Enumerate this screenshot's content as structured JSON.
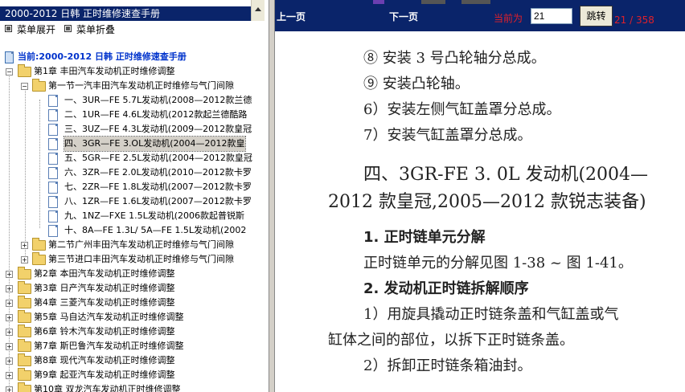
{
  "left_panel": {
    "title": "2000-2012 日韩  正时维修速查手册",
    "menu_expand": "菜单展开",
    "menu_collapse": "菜单折叠",
    "tree": {
      "root": "当前:2000-2012 日韩  正时维修速查手册",
      "chapter1": "第1章  丰田汽车发动机正时维修调整",
      "section1": "第一节一汽丰田汽车发动机正时维修与气门间隙",
      "items": [
        "一、3UR—FE 5.7L发动机(2008—2012款兰德",
        "二、1UR—FE 4.6L发动机(2012款起兰德酷路",
        "三、3UZ—FE 4.3L发动机(2009—2012款皇冠",
        "四、3GR—FE 3.OL发动机(2004—2012款皇",
        "五、5GR—FE 2.5L发动机(2004—2012款皇冠",
        "六、3ZR—FE 2.0L发动机(2010—2012款卡罗",
        "七、2ZR—FE 1.8L发动机(2007—2012款卡罗",
        "八、1ZR—FE 1.6L发动机(2007—2012款卡罗",
        "九、1NZ—FXE 1.5L发动机(2006款起普锐斯",
        "十、8A—FE 1.3L/ 5A—FE 1.5L发动机(2002"
      ],
      "section2": "第二节广州丰田汽车发动机正时维修与气门间隙",
      "section3": "第三节进口丰田汽车发动机正时维修与气门间隙",
      "chapters": [
        "第2章  本田汽车发动机正时维修调整",
        "第3章  日产汽车发动机正时维修调整",
        "第4章  三菱汽车发动机正时维修调整",
        "第5章  马自达汽车发动机正时维修调整",
        "第6章  铃木汽车发动机正时维修调整",
        "第7章  斯巴鲁汽车发动机正时维修调整",
        "第8章  现代汽车发动机正时维修调整",
        "第9章  起亚汽车发动机正时维修调整",
        "第10章  双龙汽车发动机正时维修调整"
      ]
    }
  },
  "toolbar": {
    "prev": "上一页",
    "next": "下一页",
    "current_label": "当前为",
    "page_value": "21",
    "jump": "跳转",
    "page_count": "21 / 358"
  },
  "content": {
    "lines": [
      "⑧ 安装 3 号凸轮轴分总成。",
      "⑨ 安装凸轮轴。",
      "6）安装左侧气缸盖罩分总成。",
      "7）安装气缸盖罩分总成。"
    ],
    "heading_line1": "四、3GR-FE 3. 0L 发动机(2004—",
    "heading_line2": "2012 款皇冠,2005—2012 款锐志装备)",
    "sub1": "1. 正时链单元分解",
    "sub1_text": "正时链单元的分解见图 1-38 ~ 图 1-41。",
    "sub2": "2. 发动机正时链拆解顺序",
    "step1_line1": "1）用旋具撬动正时链条盖和气缸盖或气",
    "step1_line2": "缸体之间的部位，以拆下正时链条盖。",
    "step2": "2）拆卸正时链条箱油封。"
  },
  "colors": {
    "title_bar": "#0a246a",
    "root_text": "#0033cc",
    "page_red": "#e0202a"
  }
}
